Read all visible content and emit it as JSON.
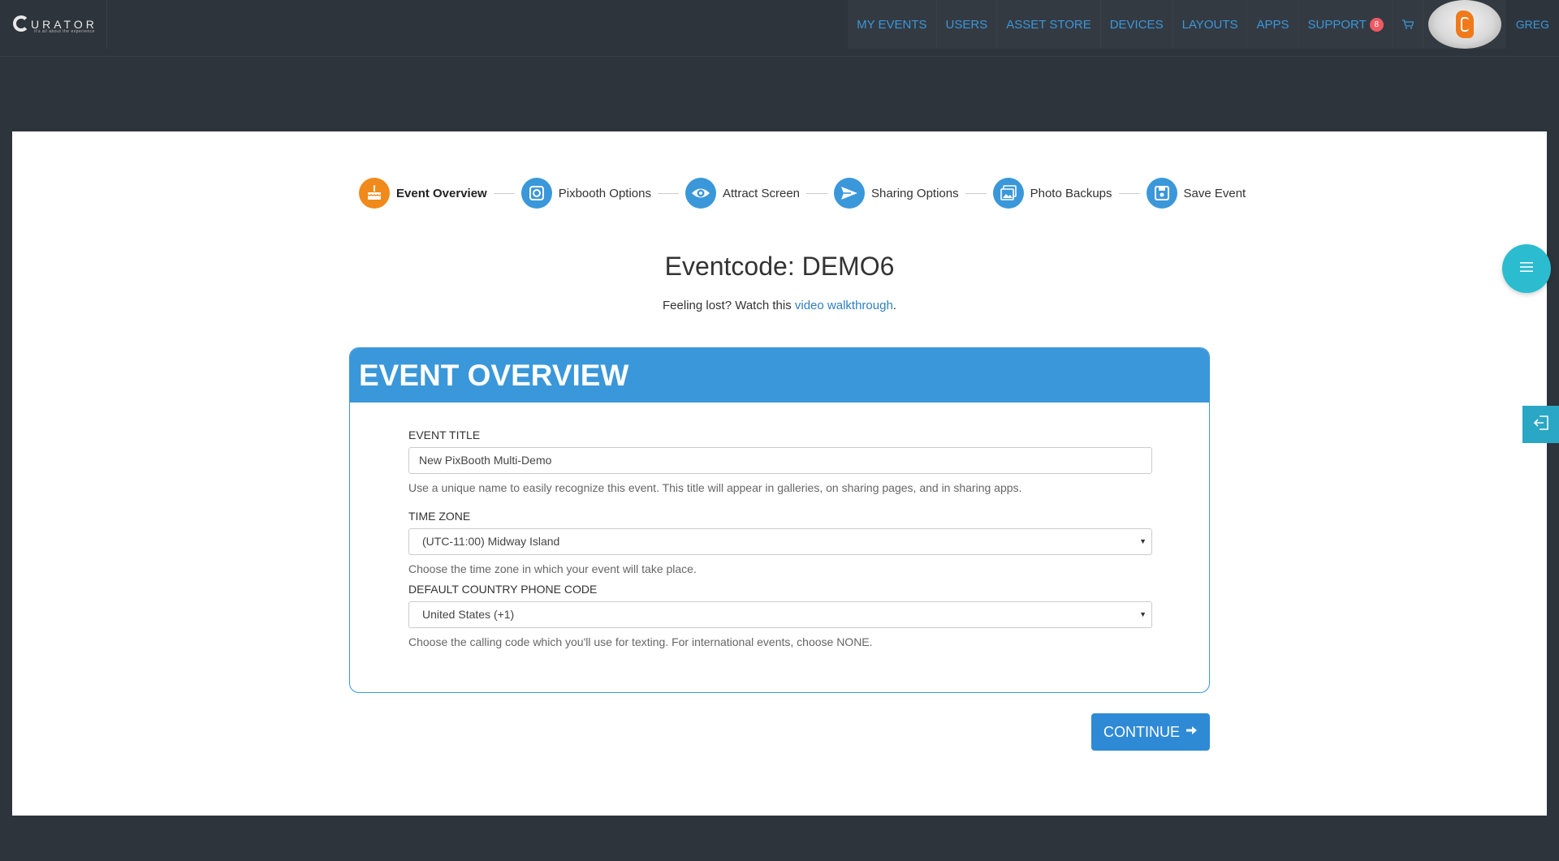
{
  "brand": {
    "name": "URATOR",
    "tagline": "it's all about the experience"
  },
  "nav": {
    "items": [
      "MY EVENTS",
      "USERS",
      "ASSET STORE",
      "DEVICES",
      "LAYOUTS",
      "APPS",
      "SUPPORT"
    ],
    "support_badge": "8",
    "user": "GREG"
  },
  "stepper": {
    "steps": [
      "Event Overview",
      "Pixbooth Options",
      "Attract Screen",
      "Sharing Options",
      "Photo Backups",
      "Save Event"
    ],
    "active_index": 0
  },
  "header": {
    "eventcode": "Eventcode: DEMO6",
    "lost_prefix": "Feeling lost? Watch this ",
    "lost_link": "video walkthrough",
    "lost_suffix": "."
  },
  "card": {
    "title": "EVENT OVERVIEW",
    "event_title": {
      "label": "EVENT TITLE",
      "value": "New PixBooth Multi-Demo",
      "help": "Use a unique name to easily recognize this event. This title will appear in galleries, on sharing pages, and in sharing apps."
    },
    "time_zone": {
      "label": "TIME ZONE",
      "value": "(UTC-11:00) Midway Island",
      "help": "Choose the time zone in which your event will take place."
    },
    "phone_code": {
      "label": "DEFAULT COUNTRY PHONE CODE",
      "value": "United States (+1)",
      "help": "Choose the calling code which you'll use for texting. For international events, choose NONE."
    }
  },
  "actions": {
    "continue": "CONTINUE"
  },
  "colors": {
    "accent": "#3a97d9",
    "active_step": "#f08a1a",
    "background": "#2e343c",
    "fab": "#2bbcd0"
  }
}
